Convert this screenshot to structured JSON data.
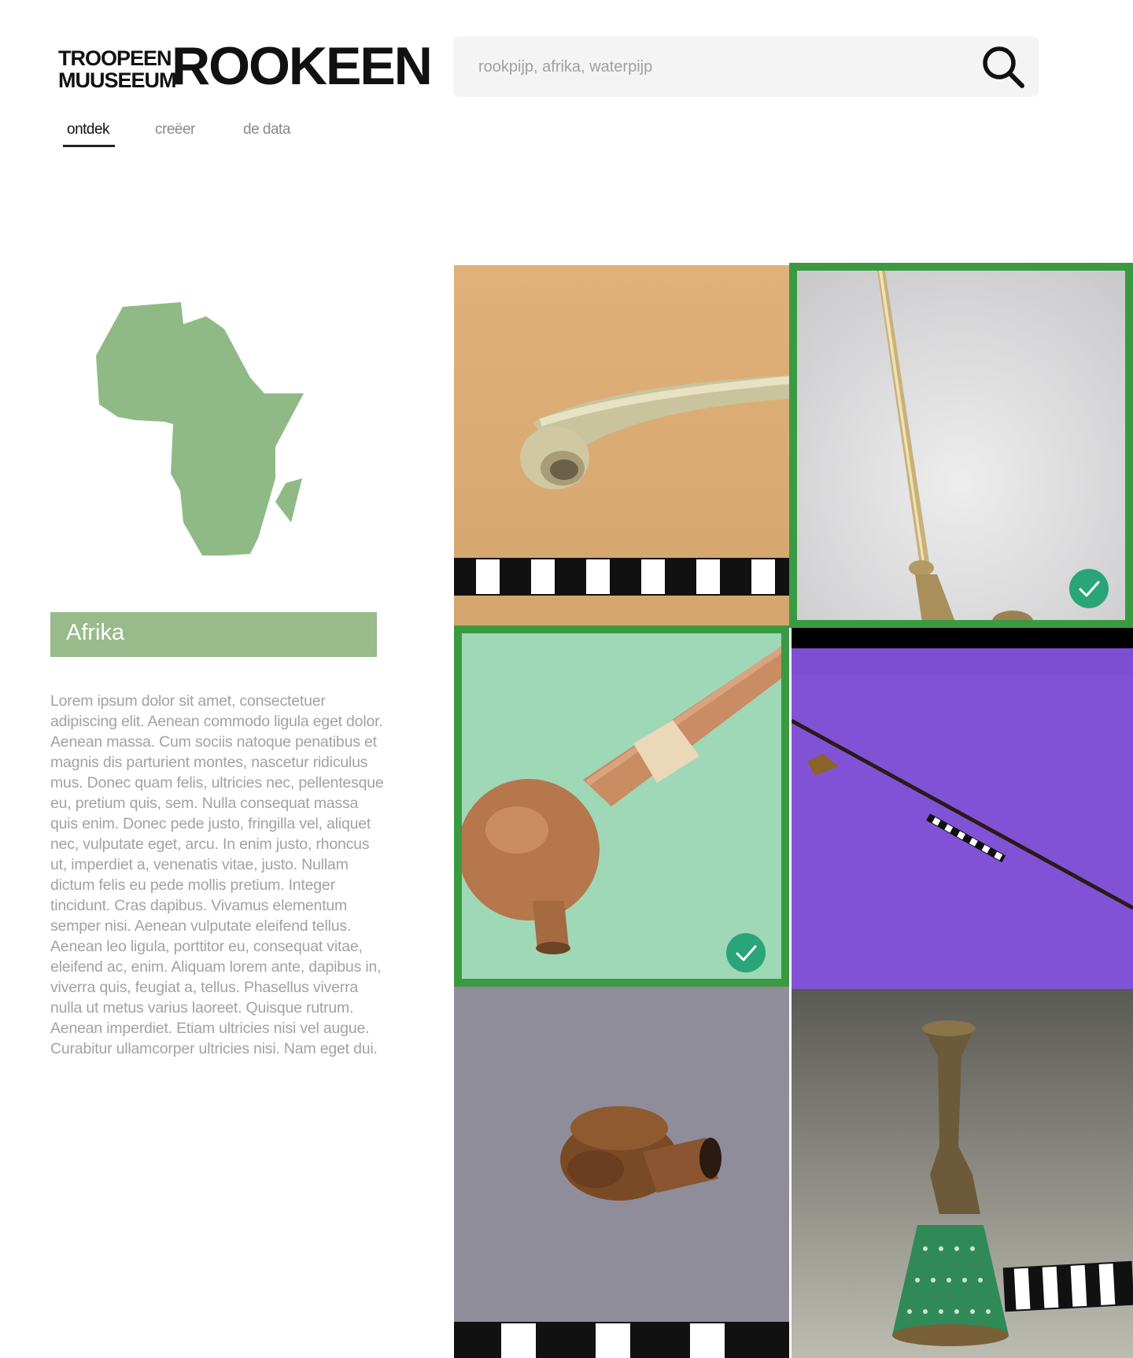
{
  "header": {
    "logo_tropen_lines": [
      "TROOPEEN",
      "MUUSEEUM"
    ],
    "logo_rooken": "ROOKEEN",
    "search": {
      "placeholder": "rookpijp, afrika, waterpijp",
      "icon": "search-icon"
    }
  },
  "nav": {
    "tabs": [
      {
        "label": "ontdek",
        "active": true
      },
      {
        "label": "creëer",
        "active": false
      },
      {
        "label": "de data",
        "active": false
      }
    ]
  },
  "region": {
    "map_icon": "africa-map-icon",
    "map_color": "#8fba85",
    "title": "Afrika",
    "description": "Lorem ipsum dolor sit amet, consectetuer adipiscing elit. Aenean commodo ligula eget dolor. Aenean massa. Cum sociis natoque penatibus et magnis dis parturient montes, nascetur ridiculus mus. Donec quam felis, ultricies nec, pellentesque eu, pretium quis, sem. Nulla consequat massa quis enim. Donec pede justo, fringilla vel, aliquet nec, vulputate eget, arcu. In enim justo, rhoncus ut, imperdiet a, venenatis vitae, justo. Nullam dictum felis eu pede mollis pretium. Integer tincidunt. Cras dapibus. Vivamus elementum semper nisi. Aenean vulputate eleifend tellus. Aenean leo ligula, porttitor eu, consequat vitae, eleifend ac, enim. Aliquam lorem ante, dapibus in, viverra quis, feugiat a, tellus. Phasellus viverra nulla ut metus varius laoreet. Quisque rutrum. Aenean imperdiet. Etiam ultricies nisi vel augue. Curabitur ullamcorper ultricies nisi. Nam eget dui."
  },
  "results": {
    "selection_color": "#3a9a41",
    "check_color": "#2aa57a",
    "items": [
      {
        "subject": "clay-pipe",
        "selected": false
      },
      {
        "subject": "brass-long-pipe",
        "selected": true
      },
      {
        "subject": "wooden-bowl-pipe",
        "selected": true
      },
      {
        "subject": "long-stem-pipe-on-purple",
        "selected": false
      },
      {
        "subject": "carved-wooden-pipe",
        "selected": false
      },
      {
        "subject": "beaded-waterpipe-base",
        "selected": false
      }
    ]
  }
}
